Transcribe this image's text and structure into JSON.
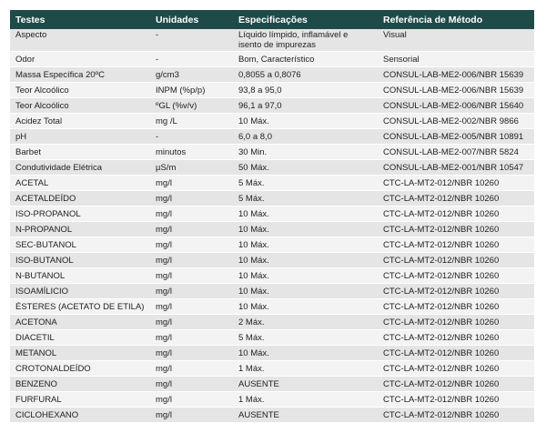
{
  "headers": [
    "Testes",
    "Unidades",
    "Especificações",
    "Referência de Método"
  ],
  "rows": [
    {
      "teste": "Aspecto",
      "unidade": "-",
      "especificacao": "Líquido límpido, inflamável e isento de impurezas",
      "referencia": "Visual"
    },
    {
      "teste": "Odor",
      "unidade": "-",
      "especificacao": "Bom, Característico",
      "referencia": "Sensorial"
    },
    {
      "teste": "Massa Específica 20ºC",
      "unidade": "g/cm3",
      "especificacao": "0,8055 a 0,8076",
      "referencia": "CONSUL-LAB-ME2-006/NBR 15639"
    },
    {
      "teste": "Teor Alcoólico",
      "unidade": "INPM (%p/p)",
      "especificacao": "93,8 a 95,0",
      "referencia": "CONSUL-LAB-ME2-006/NBR 15639"
    },
    {
      "teste": "Teor Alcoólico",
      "unidade": "ºGL (%v/v)",
      "especificacao": "96,1 a 97,0",
      "referencia": "CONSUL-LAB-ME2-006/NBR 15640"
    },
    {
      "teste": "Acidez Total",
      "unidade": "mg /L",
      "especificacao": "10 Máx.",
      "referencia": "CONSUL-LAB-ME2-002/NBR 9866"
    },
    {
      "teste": "pH",
      "unidade": "-",
      "especificacao": "6,0 a 8,0",
      "referencia": "CONSUL-LAB-ME2-005/NBR 10891"
    },
    {
      "teste": "Barbet",
      "unidade": "minutos",
      "especificacao": "30 Min.",
      "referencia": "CONSUL-LAB-ME2-007/NBR 5824"
    },
    {
      "teste": "Condutividade Elétrica",
      "unidade": "µS/m",
      "especificacao": "50 Máx.",
      "referencia": "CONSUL-LAB-ME2-001/NBR 10547"
    },
    {
      "teste": "ACETAL",
      "unidade": "mg/l",
      "especificacao": "5 Máx.",
      "referencia": "CTC-LA-MT2-012/NBR 10260"
    },
    {
      "teste": "ACETALDEÍDO",
      "unidade": "mg/l",
      "especificacao": "5 Máx.",
      "referencia": "CTC-LA-MT2-012/NBR 10260"
    },
    {
      "teste": "ISO-PROPANOL",
      "unidade": "mg/l",
      "especificacao": "10 Máx.",
      "referencia": "CTC-LA-MT2-012/NBR 10260"
    },
    {
      "teste": "N-PROPANOL",
      "unidade": "mg/l",
      "especificacao": "10 Máx.",
      "referencia": "CTC-LA-MT2-012/NBR 10260"
    },
    {
      "teste": "SEC-BUTANOL",
      "unidade": "mg/l",
      "especificacao": "10 Máx.",
      "referencia": "CTC-LA-MT2-012/NBR 10260"
    },
    {
      "teste": "ISO-BUTANOL",
      "unidade": "mg/l",
      "especificacao": "10 Máx.",
      "referencia": "CTC-LA-MT2-012/NBR 10260"
    },
    {
      "teste": "N-BUTANOL",
      "unidade": "mg/l",
      "especificacao": "10 Máx.",
      "referencia": "CTC-LA-MT2-012/NBR 10260"
    },
    {
      "teste": "ISOAMÍLICIO",
      "unidade": "mg/l",
      "especificacao": "10 Máx.",
      "referencia": "CTC-LA-MT2-012/NBR 10260"
    },
    {
      "teste": "ÉSTERES (ACETATO DE ETILA)",
      "unidade": "mg/l",
      "especificacao": "10 Máx.",
      "referencia": "CTC-LA-MT2-012/NBR 10260"
    },
    {
      "teste": "ACETONA",
      "unidade": "mg/l",
      "especificacao": "2 Máx.",
      "referencia": "CTC-LA-MT2-012/NBR 10260"
    },
    {
      "teste": "DIACETIL",
      "unidade": "mg/l",
      "especificacao": "5 Máx.",
      "referencia": "CTC-LA-MT2-012/NBR 10260"
    },
    {
      "teste": "METANOL",
      "unidade": "mg/l",
      "especificacao": "10 Máx.",
      "referencia": "CTC-LA-MT2-012/NBR 10260"
    },
    {
      "teste": "CROTONALDEÍDO",
      "unidade": "mg/l",
      "especificacao": "1 Máx.",
      "referencia": "CTC-LA-MT2-012/NBR 10260"
    },
    {
      "teste": "BENZENO",
      "unidade": "mg/l",
      "especificacao": "AUSENTE",
      "referencia": "CTC-LA-MT2-012/NBR 10260"
    },
    {
      "teste": "FURFURAL",
      "unidade": "mg/l",
      "especificacao": " 1 Máx.",
      "referencia": "CTC-LA-MT2-012/NBR 10260"
    },
    {
      "teste": "CICLOHEXANO",
      "unidade": "mg/l",
      "especificacao": "AUSENTE",
      "referencia": "CTC-LA-MT2-012/NBR 10260"
    }
  ]
}
